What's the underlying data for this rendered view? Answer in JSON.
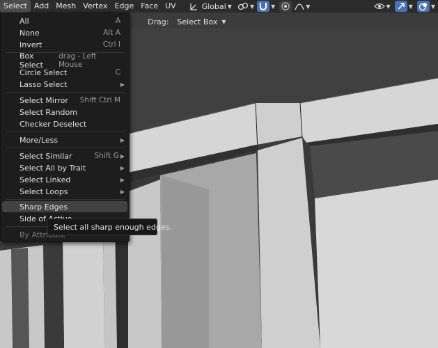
{
  "header": {
    "menus": [
      "Select",
      "Add",
      "Mesh",
      "Vertex",
      "Edge",
      "Face",
      "UV"
    ],
    "transform_orientation": "Global",
    "icons": [
      "orientation-icon",
      "link-icon",
      "snap-magnet-icon",
      "proportional-icon",
      "falloff-icon",
      "visibility-icon",
      "gizmo-icon",
      "overlay-icon"
    ]
  },
  "toolbar": {
    "drag_label": "Drag:",
    "drag_value": "Select Box"
  },
  "select_menu": {
    "items": [
      {
        "label": "All",
        "shortcut": "A"
      },
      {
        "label": "None",
        "shortcut": "Alt A"
      },
      {
        "label": "Invert",
        "shortcut": "Ctrl I"
      },
      {
        "label": "Box Select",
        "shortcut": "drag - Left Mouse"
      },
      {
        "label": "Circle Select",
        "shortcut": "C"
      },
      {
        "label": "Lasso Select",
        "shortcut": ""
      },
      {
        "label": "Select Mirror",
        "shortcut": "Shift Ctrl M"
      },
      {
        "label": "Select Random",
        "shortcut": ""
      },
      {
        "label": "Checker Deselect",
        "shortcut": ""
      },
      {
        "label": "More/Less",
        "shortcut": ""
      },
      {
        "label": "Select Similar",
        "shortcut": "Shift G"
      },
      {
        "label": "Select All by Trait",
        "shortcut": ""
      },
      {
        "label": "Select Linked",
        "shortcut": ""
      },
      {
        "label": "Select Loops",
        "shortcut": ""
      },
      {
        "label": "Sharp Edges",
        "shortcut": ""
      },
      {
        "label": "Side of Active",
        "shortcut": ""
      },
      {
        "label": "By Attribute",
        "shortcut": ""
      }
    ]
  },
  "tooltip": {
    "text": "Select all sharp enough edges."
  },
  "colors": {
    "header_bg": "#2b2b2b",
    "menu_bg": "#1d1d1d",
    "highlight": "#424242",
    "accent_blue": "#4772b3"
  }
}
